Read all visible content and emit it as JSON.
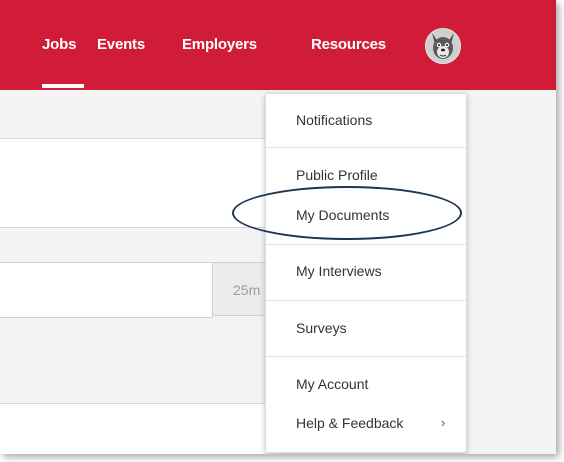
{
  "nav": {
    "jobs": "Jobs",
    "events": "Events",
    "employers": "Employers",
    "resources": "Resources"
  },
  "search": {
    "radius_text": "25m"
  },
  "menu": {
    "items": [
      "Notifications",
      "Public Profile",
      "My Documents",
      "My Interviews",
      "Surveys",
      "My Account",
      "Help & Feedback"
    ],
    "submenu_chevron": "›"
  },
  "colors": {
    "header": "#d01c36",
    "highlight_ring": "#1e3550"
  }
}
